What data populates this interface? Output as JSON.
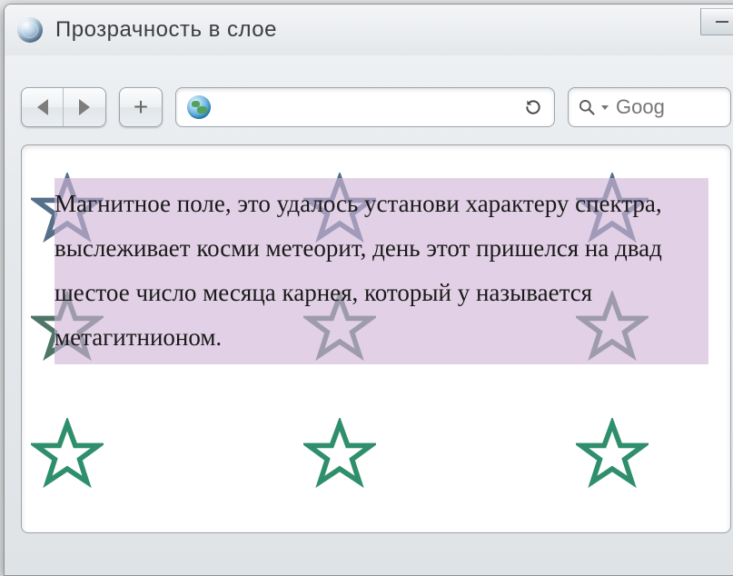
{
  "window": {
    "title": "Прозрачность в слое"
  },
  "toolbar": {
    "plus_label": "+"
  },
  "search": {
    "placeholder": "Goog"
  },
  "content": {
    "body_text": "Магнитное поле, это удалось установи характеру спектра, выслеживает косми метеорит, день этот пришелся на двад шестое число месяца карнея, который у называется метагитнионом."
  },
  "icons": {
    "star_stroke_top": "#56708a",
    "star_stroke_mid": "#4e7566",
    "star_stroke_bottom": "#2f8f6c"
  }
}
